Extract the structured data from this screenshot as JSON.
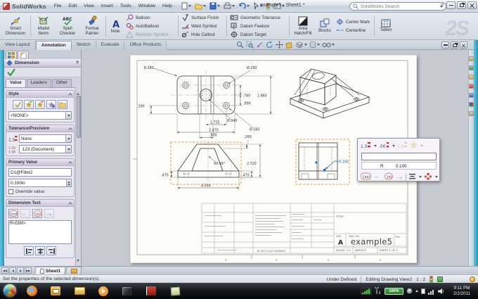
{
  "app": {
    "name": "SolidWorks",
    "doc_title": "example5 - Sheet1 *",
    "search_placeholder": "SolidWorks Search",
    "help_label": "?",
    "watermark": "2S"
  },
  "menu": {
    "items": [
      "File",
      "Edit",
      "View",
      "Insert",
      "Tools",
      "Window",
      "Help"
    ]
  },
  "ribbon": {
    "smart_dimension": "Smart Dimension",
    "model_items": "Model Items",
    "spell_checker": "Spell Checker",
    "format_painter": "Format Painter",
    "note": "Note",
    "balloon": "Balloon",
    "autoballoon": "AutoBalloon",
    "revision_symbol": "Revision Symbol",
    "surface_finish": "Surface Finish",
    "weld_symbol": "Weld Symbol",
    "hole_callout": "Hole Callout",
    "geometric_tolerance": "Geometric Tolerance",
    "datum_feature": "Datum Feature",
    "datum_target": "Datum Target",
    "area_hatch": "Area Hatch/Fill",
    "blocks": "Blocks",
    "center_mark": "Center Mark",
    "centerline": "Centerline",
    "tables": "Tables"
  },
  "command_tabs": {
    "items": [
      "View Layout",
      "Annotation",
      "Sketch",
      "Evaluate",
      "Office Products"
    ]
  },
  "panel": {
    "title": "Dimension",
    "help_label": "?",
    "tabs": [
      "Value",
      "Leaders",
      "Other"
    ],
    "style": {
      "title": "Style",
      "selected": "<NONE>"
    },
    "tolerance": {
      "title": "Tolerance/Precision",
      "type_value": "None",
      "precision_value": ".123 (Document)"
    },
    "primary": {
      "title": "Primary Value",
      "name": "D1@Fillet2",
      "value": "0.100in",
      "override_label": "Override value:"
    },
    "dim_text": {
      "title": "Dimension Text",
      "text": "R<DIM>"
    }
  },
  "drawing": {
    "dims": {
      "r380": "R.380",
      "d290": "Ø.290",
      "d390": ".390",
      "d780": ".780",
      "d2860": "2.860",
      "d890": ".890",
      "d1735": "1.735",
      "d940": "Ø.940",
      "d3470": "3.470",
      "d800": ".800",
      "d560": "Ø.560",
      "d260": ".260",
      "d2720": "2.720",
      "angle": "99.99°",
      "d470l": ".470",
      "d470r": ".470",
      "d4590": "4.590",
      "r100": "R.100"
    },
    "title_block": {
      "title_label": "TITLE:",
      "size_label": "SIZE",
      "size_value": "A",
      "dwg_label": "DWG.  NO.",
      "dwg_no": "example5",
      "rev_label": "REV",
      "scale_label": "SCALE: 1:2",
      "weight_label": "WEIGHT:",
      "sheet_label": "SHEET 1 OF 1",
      "note": "DO NOT SCALE DRAWING",
      "zones": [
        "4",
        "3",
        "2",
        "1"
      ]
    }
  },
  "popup": {
    "prefix": "R",
    "value": "0.100"
  },
  "sheet_bar": {
    "tab": "Sheet1"
  },
  "status": {
    "message": "Set the properties of the selected dimension(s).",
    "state": "Under Defined",
    "mode": "Editing Drawing View2",
    "scale": "1 : 2"
  },
  "taskbar": {
    "battery": "100%",
    "time": "9:11 PM",
    "date": "2/2/2011"
  }
}
